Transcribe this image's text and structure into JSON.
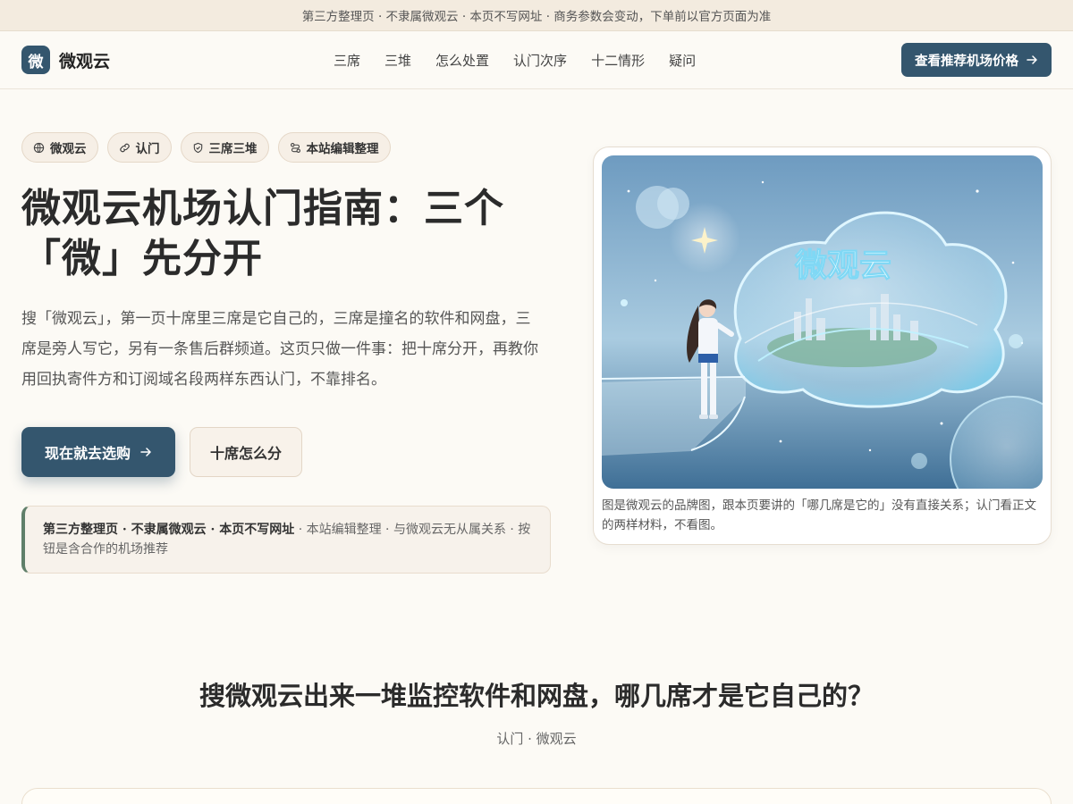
{
  "notice": "第三方整理页 · 不隶属微观云 · 本页不写网址 · 商务参数会变动，下单前以官方页面为准",
  "brand": {
    "mark": "微",
    "name": "微观云"
  },
  "nav": {
    "links": [
      "三席",
      "三堆",
      "怎么处置",
      "认门次序",
      "十二情形",
      "疑问"
    ],
    "cta": "查看推荐机场价格"
  },
  "hero": {
    "chips": [
      "微观云",
      "认门",
      "三席三堆",
      "本站编辑整理"
    ],
    "title": "微观云机场认门指南：三个「微」先分开",
    "description": "搜「微观云」，第一页十席里三席是它自己的，三席是撞名的软件和网盘，三席是旁人写它，另有一条售后群频道。这页只做一件事：把十席分开，再教你用回执寄件方和订阅域名段两样东西认门，不靠排名。",
    "primary_button": "现在就去选购",
    "secondary_button": "十席怎么分",
    "disclaimer_strong": "第三方整理页 · 不隶属微观云 · 本页不写网址",
    "disclaimer_rest": " · 本站编辑整理 · 与微观云无从属关系 · 按钮是含合作的机场推荐"
  },
  "image": {
    "brand_text": "微观云",
    "caption": "图是微观云的品牌图，跟本页要讲的「哪几席是它的」没有直接关系；认门看正文的两样材料，不看图。"
  },
  "section": {
    "title": "搜微观云出来一堆监控软件和网盘，哪几席才是它自己的？",
    "subtitle": "认门 · 微观云"
  },
  "colors": {
    "accent": "#34566e",
    "background": "#fcfaf5",
    "chip_bg": "#f6efe6",
    "disclaimer_border": "#5f7f6a"
  },
  "icons": {
    "chips": [
      "globe-icon",
      "link-icon",
      "shield-icon",
      "route-icon"
    ],
    "arrow": "arrow-right-icon"
  }
}
